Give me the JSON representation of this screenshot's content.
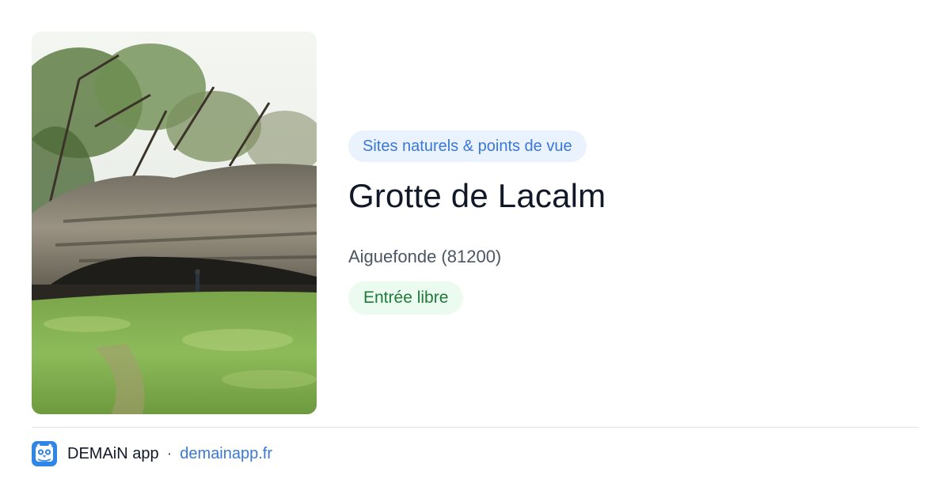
{
  "card": {
    "category": "Sites naturels & points de vue",
    "title": "Grotte de Lacalm",
    "location": "Aiguefonde (81200)",
    "access": "Entrée libre",
    "photo_alt": "Grotte de Lacalm"
  },
  "footer": {
    "app_name": "DEMAiN app",
    "separator": "·",
    "site": "demainapp.fr"
  },
  "colors": {
    "category_bg": "#eaf2fd",
    "category_text": "#3a78d6",
    "status_bg": "#ecfbef",
    "status_text": "#1f7a3a",
    "brand": "#2f86e6",
    "link": "#3a78d6"
  },
  "icons": {
    "app": "owl-logo-icon"
  }
}
